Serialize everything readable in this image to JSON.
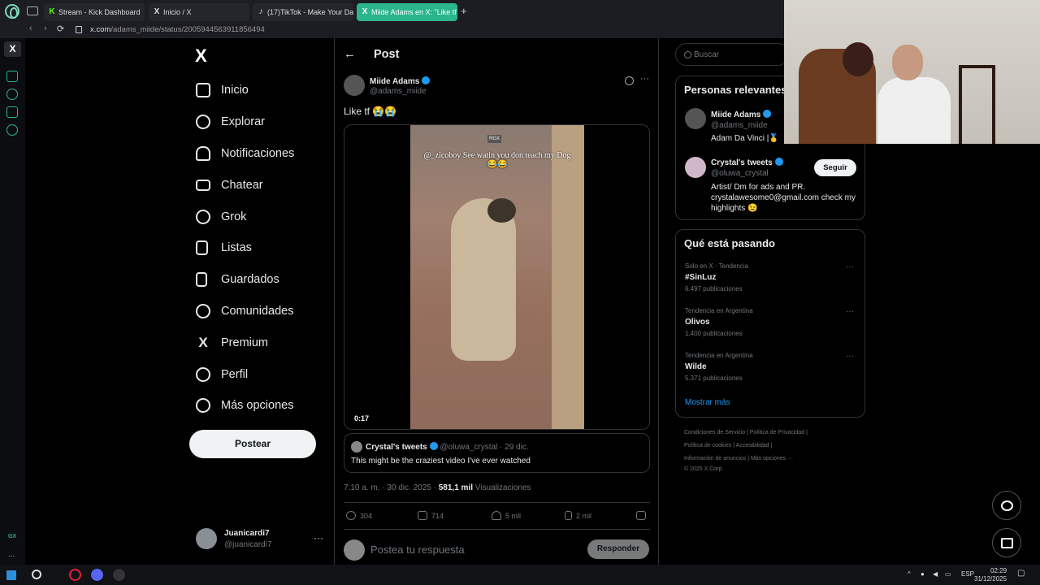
{
  "browser": {
    "tabs": [
      {
        "label": "Stream - Kick Dashboard",
        "icon": "K"
      },
      {
        "label": "Inicio / X",
        "icon": "X"
      },
      {
        "label": "(17)TikTok - Make Your Da",
        "icon": "♪"
      },
      {
        "label": "Miide Adams en X: \"Like tf",
        "icon": "X"
      }
    ],
    "new_tab": "+",
    "url_host": "x.com",
    "url_path": "/adams_miide/status/2005944563911856494",
    "back": "‹",
    "forward": "›",
    "reload": "⟳"
  },
  "opera_sidebar": {
    "x": "X",
    "gx": "GX",
    "more": "..."
  },
  "x_nav": {
    "logo": "X",
    "items": [
      {
        "label": "Inicio",
        "icon": "home-icon"
      },
      {
        "label": "Explorar",
        "icon": "search-icon"
      },
      {
        "label": "Notificaciones",
        "icon": "bell-icon"
      },
      {
        "label": "Chatear",
        "icon": "mail-icon"
      },
      {
        "label": "Grok",
        "icon": "grok-icon"
      },
      {
        "label": "Listas",
        "icon": "list-icon"
      },
      {
        "label": "Guardados",
        "icon": "bookmark-icon"
      },
      {
        "label": "Comunidades",
        "icon": "people-icon"
      },
      {
        "label": "Premium",
        "icon": "x-icon"
      },
      {
        "label": "Perfil",
        "icon": "user-icon"
      },
      {
        "label": "Más opciones",
        "icon": "more-circle-icon"
      }
    ],
    "post_button": "Postear",
    "account": {
      "name": "Juanicardi7",
      "handle": "@juanicardi7",
      "more": "···"
    }
  },
  "post": {
    "header_back": "←",
    "header_title": "Post",
    "author_name": "Miide Adams",
    "author_handle": "@adams_miide",
    "more": "···",
    "text": "Like tf 😭😭",
    "video": {
      "watermark": "RGX",
      "caption": "@_zicoboy See watin you don teach my Dog 😂😂",
      "time": "0:17"
    },
    "quote": {
      "name": "Crystal's tweets",
      "handle": "@oluwa_crystal",
      "date": "· 29 dic.",
      "text": "This might be the craziest video I've ever watched"
    },
    "meta_time": "7:10 a. m. · 30 dic. 2025 ·",
    "views_count": "581,1 mil",
    "views_label": "Visualizaciones",
    "actions": [
      {
        "icon": "reply-icon",
        "count": "304"
      },
      {
        "icon": "retweet-icon",
        "count": "714"
      },
      {
        "icon": "heart-icon",
        "count": "5 mil"
      },
      {
        "icon": "bookmark-icon",
        "count": "2 mil"
      },
      {
        "icon": "share-icon",
        "count": ""
      }
    ],
    "reply_placeholder": "Postea tu respuesta",
    "reply_button": "Responder"
  },
  "sidebar": {
    "search_placeholder": "Buscar",
    "relevant": {
      "title": "Personas relevantes",
      "people": [
        {
          "name": "Miide Adams",
          "handle": "@adams_miide",
          "bio": "Adam Da Vinci |🥇"
        },
        {
          "name": "Crystal's tweets",
          "handle": "@oluwa_crystal",
          "bio": "Artist/ Dm for ads and PR. crystalawesome0@gmail.com check my highlights 😉",
          "follow": "Seguir"
        }
      ]
    },
    "trends": {
      "title": "Qué está pasando",
      "items": [
        {
          "category": "Solo en X · Tendencia",
          "topic": "#SinLuz",
          "count": "6.497 publicaciones"
        },
        {
          "category": "Tendencia en Argentina",
          "topic": "Olivos",
          "count": "1.400 publicaciones"
        },
        {
          "category": "Tendencia en Argentina",
          "topic": "Wilde",
          "count": "5.371 publicaciones"
        }
      ],
      "more": "Mostrar más"
    },
    "footer": [
      "Condiciones de Servicio  |  Política de Privacidad  |",
      "Política de cookies  |  Accesibilidad  |",
      "Información de anuncios  |  Más opciones ···",
      "© 2025 X Corp."
    ]
  },
  "taskbar": {
    "lang": "ESP",
    "time": "02:29",
    "date": "31/12/2025"
  },
  "colors": {
    "accent": "#1d9bf0",
    "opera": "#2bb58f",
    "bg": "#000000",
    "border": "#2f3336"
  }
}
